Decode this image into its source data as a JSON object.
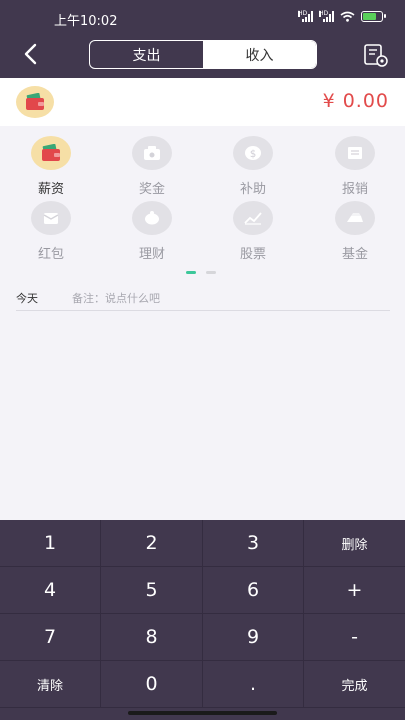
{
  "status_bar": {
    "time": "上午10:02",
    "signal_label": "HD",
    "battery_color": "#5ad15a"
  },
  "header": {
    "back_icon": "chevron-left-icon",
    "tabs": [
      {
        "label": "支出",
        "active": false
      },
      {
        "label": "收入",
        "active": true
      }
    ],
    "bill_icon": "bill-settings-icon"
  },
  "amount": {
    "value": "¥ 0.00",
    "selected_icon": "wallet-icon",
    "color": "#e24b4b"
  },
  "categories": [
    {
      "label": "薪资",
      "icon": "wallet-icon",
      "selected": true
    },
    {
      "label": "奖金",
      "icon": "bonus-icon",
      "selected": false
    },
    {
      "label": "补助",
      "icon": "subsidy-coin-icon",
      "selected": false
    },
    {
      "label": "报销",
      "icon": "reimburse-ticket-icon",
      "selected": false
    },
    {
      "label": "红包",
      "icon": "red-envelope-icon",
      "selected": false
    },
    {
      "label": "理财",
      "icon": "piggy-bank-icon",
      "selected": false
    },
    {
      "label": "股票",
      "icon": "stock-chart-icon",
      "selected": false
    },
    {
      "label": "基金",
      "icon": "fund-gold-icon",
      "selected": false
    }
  ],
  "pager": {
    "pages": 2,
    "current": 1,
    "accent": "#3cc79a"
  },
  "note": {
    "date_label": "今天",
    "placeholder": "备注：说点什么吧"
  },
  "keypad": {
    "keys": [
      "1",
      "2",
      "3",
      "删除",
      "4",
      "5",
      "6",
      "+",
      "7",
      "8",
      "9",
      "-",
      "清除",
      "0",
      ".",
      "完成"
    ]
  },
  "colors": {
    "header_bg": "#41384e",
    "accent_yellow": "#f6dfa6"
  }
}
